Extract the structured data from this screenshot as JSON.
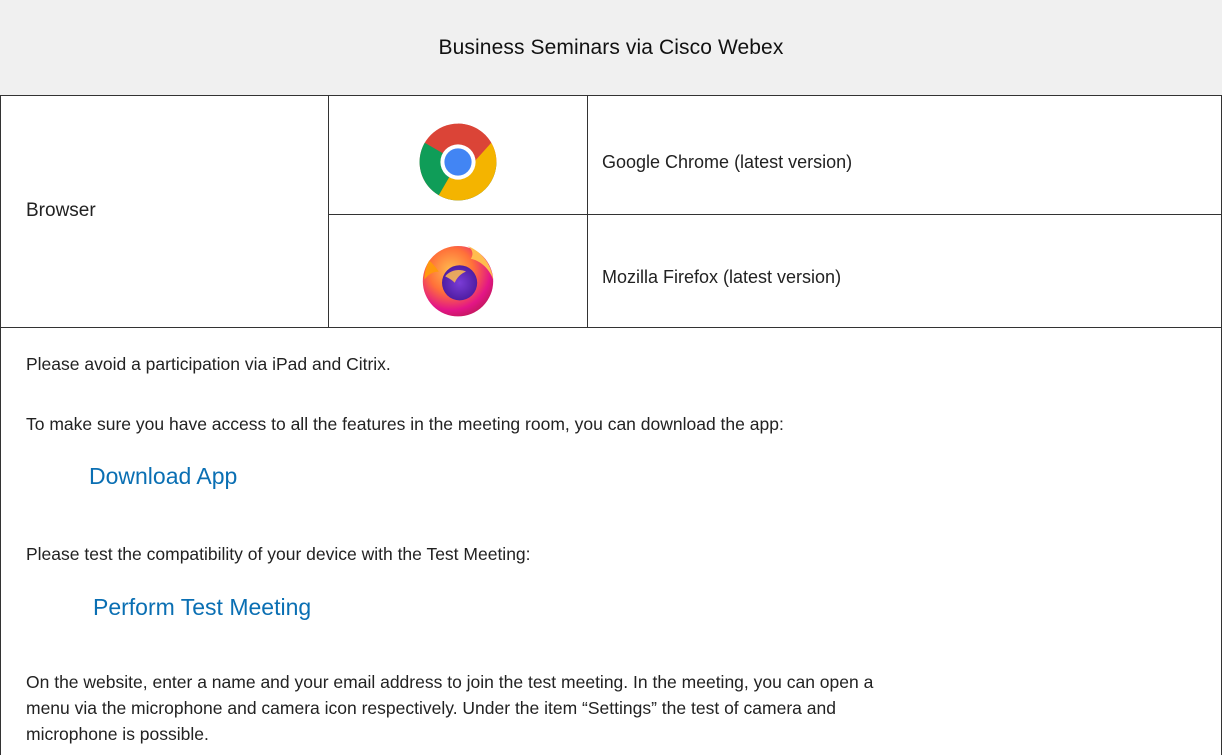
{
  "header": {
    "title": "Business Seminars via Cisco Webex"
  },
  "browser_section": {
    "label": "Browser",
    "browsers": [
      {
        "icon": "chrome-logo-icon",
        "name": "Google Chrome (latest version)"
      },
      {
        "icon": "firefox-logo-icon",
        "name": "Mozilla Firefox (latest version)"
      }
    ]
  },
  "info": {
    "avoid_text": "Please avoid a participation via iPad and Citrix.",
    "download_intro": "To make sure you have access to all the features in the meeting room, you can download the app:",
    "download_link": "Download App",
    "test_intro": "Please test the compatibility of your device with the Test Meeting:",
    "test_link": "Perform Test Meeting",
    "instructions_line1": "On the website, enter a name and your email address to join the test meeting. In the meeting, you can open a",
    "instructions_line2": "menu via the microphone and camera icon respectively. Under the item “Settings” the test of camera and",
    "instructions_line3": "microphone is possible."
  },
  "colors": {
    "link": "#0a6fb3",
    "header_bg": "#f0f0f0",
    "border": "#333333"
  }
}
